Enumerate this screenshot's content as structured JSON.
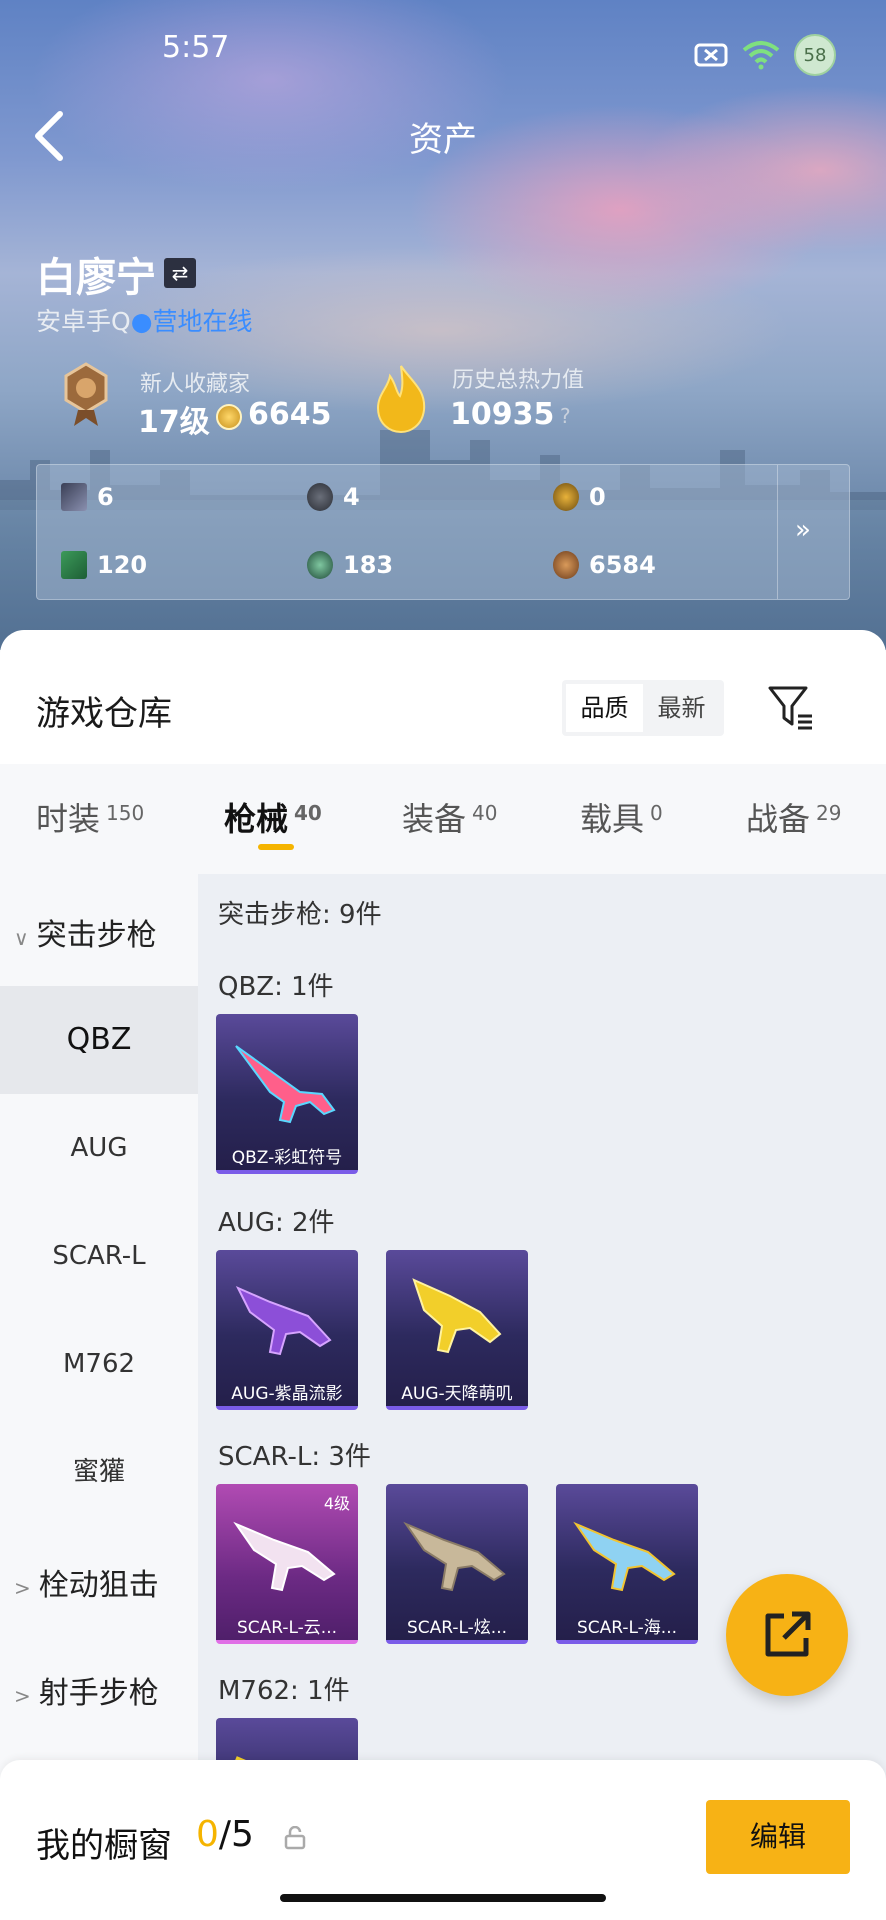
{
  "status": {
    "time": "5:57",
    "battery": "58"
  },
  "header": {
    "title": "资产"
  },
  "user": {
    "name": "白廖宁",
    "swap": "⇄",
    "platform": "安卓手Q",
    "online": "●营地在线"
  },
  "collector": {
    "title": "新人收藏家",
    "level": "17级",
    "coins": "6645"
  },
  "heat": {
    "title": "历史总热力值",
    "value": "10935",
    "help": "?"
  },
  "stats": {
    "row1": [
      "6",
      "4",
      "0"
    ],
    "row2": [
      "120",
      "183",
      "6584"
    ],
    "more": "»"
  },
  "warehouse": {
    "title": "游戏仓库",
    "sort": [
      "品质",
      "最新"
    ]
  },
  "tabs": [
    {
      "label": "时装",
      "count": "150"
    },
    {
      "label": "枪械",
      "count": "40"
    },
    {
      "label": "装备",
      "count": "40"
    },
    {
      "label": "载具",
      "count": "0"
    },
    {
      "label": "战备",
      "count": "29"
    }
  ],
  "sidebar": {
    "group_open": "突击步枪",
    "items": [
      "QBZ",
      "AUG",
      "SCAR-L",
      "M762",
      "蜜獾"
    ],
    "group2": "栓动狙击",
    "group3": "射手步枪"
  },
  "content": {
    "summary": "突击步枪: 9件",
    "sections": [
      {
        "label": "QBZ: 1件",
        "cards": [
          {
            "name": "QBZ-彩虹符号"
          }
        ]
      },
      {
        "label": "AUG: 2件",
        "cards": [
          {
            "name": "AUG-紫晶流影"
          },
          {
            "name": "AUG-天降萌叽"
          }
        ]
      },
      {
        "label": "SCAR-L: 3件",
        "cards": [
          {
            "name": "SCAR-L-云...",
            "level": "4级"
          },
          {
            "name": "SCAR-L-炫..."
          },
          {
            "name": "SCAR-L-海..."
          }
        ]
      },
      {
        "label": "M762: 1件"
      }
    ]
  },
  "bottom": {
    "label": "我的橱窗",
    "count_num": "0",
    "count_total": "/5",
    "edit": "编辑"
  },
  "colors": {
    "accent": "#f7b215",
    "online": "#3a8dff"
  }
}
